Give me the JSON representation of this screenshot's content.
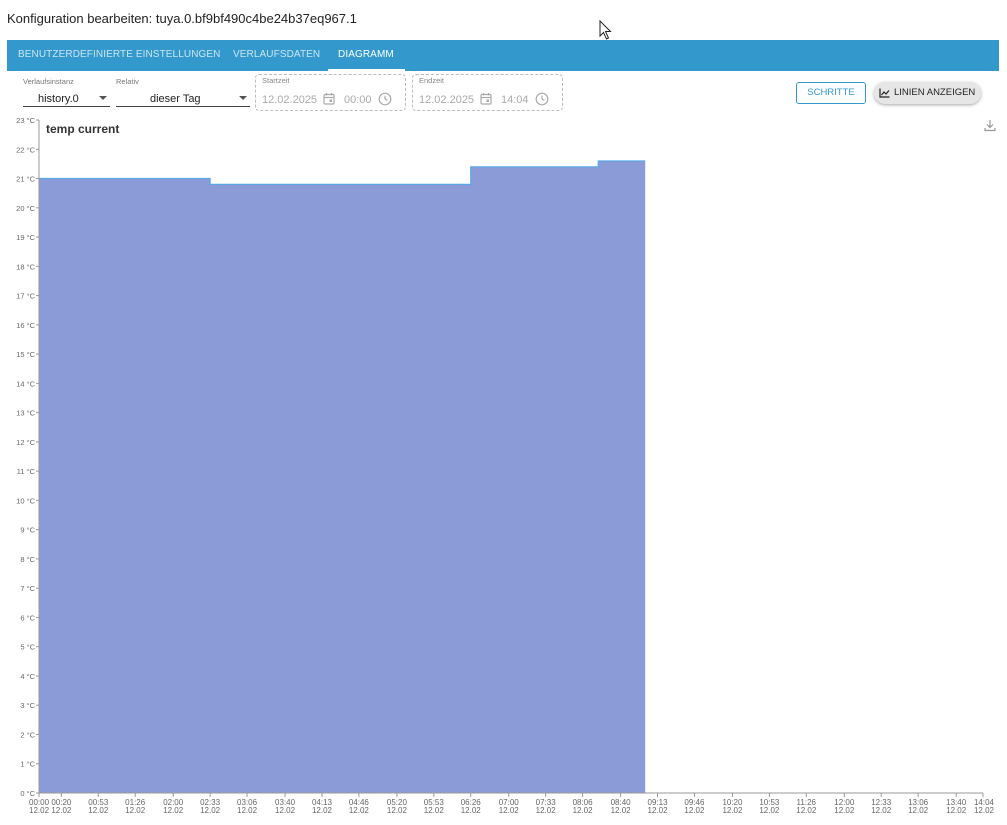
{
  "window": {
    "title": "Konfiguration bearbeiten: tuya.0.bf9bf490c4be24b37eq967.1"
  },
  "tabs": [
    {
      "label": "BENUTZERDEFINIERTE EINSTELLUNGEN",
      "active": false
    },
    {
      "label": "VERLAUFSDATEN",
      "active": false
    },
    {
      "label": "DIAGRAMM",
      "active": true
    }
  ],
  "controls": {
    "history_instance": {
      "label": "Verlaufsinstanz",
      "value": "history.0"
    },
    "relative": {
      "label": "Relativ",
      "value": "dieser Tag"
    },
    "start": {
      "label": "Startzeit",
      "date": "12.02.2025",
      "time": "00:00"
    },
    "end": {
      "label": "Endzeit",
      "date": "12.02.2025",
      "time": "14:04"
    },
    "steps_button": "SCHRITTE",
    "lines_button": "LINIEN ANZEIGEN"
  },
  "icons": {
    "tab_cursor": "mouse-pointer-icon",
    "calendar": "calendar-icon",
    "clock": "clock-icon",
    "chart_line": "chart-line-icon",
    "download": "download-icon"
  },
  "colors": {
    "tabbar": "#3399cc",
    "area_fill": "#8a9bd8",
    "area_stroke": "#5aa7e8"
  },
  "chart_data": {
    "type": "area",
    "title": "temp current",
    "unit": "°C",
    "step": true,
    "ylim": [
      0,
      23
    ],
    "y_ticks": [
      "0 °C",
      "1 °C",
      "2 °C",
      "3 °C",
      "4 °C",
      "5 °C",
      "6 °C",
      "7 °C",
      "8 °C",
      "9 °C",
      "10 °C",
      "11 °C",
      "12 °C",
      "13 °C",
      "14 °C",
      "15 °C",
      "16 °C",
      "17 °C",
      "18 °C",
      "19 °C",
      "20 °C",
      "21 °C",
      "22 °C",
      "23 °C"
    ],
    "x_ticks": [
      "00:00",
      "00:20",
      "00:53",
      "01:26",
      "02:00",
      "02:33",
      "03:06",
      "03:40",
      "04:13",
      "04:46",
      "05:20",
      "05:53",
      "06:26",
      "07:00",
      "07:33",
      "08:06",
      "08:40",
      "09:13",
      "09:46",
      "10:20",
      "10:53",
      "11:26",
      "12:00",
      "12:33",
      "13:06",
      "13:40",
      "14:04"
    ],
    "x_tick_date": "12.02",
    "x_range": [
      "00:00",
      "14:04"
    ],
    "series": [
      {
        "points": [
          {
            "x": "00:00",
            "y": 21.0
          },
          {
            "x": "02:33",
            "y": 20.8
          },
          {
            "x": "06:26",
            "y": 21.4
          },
          {
            "x": "08:20",
            "y": 21.6
          },
          {
            "x": "09:02",
            "y": 21.6
          }
        ]
      }
    ]
  }
}
